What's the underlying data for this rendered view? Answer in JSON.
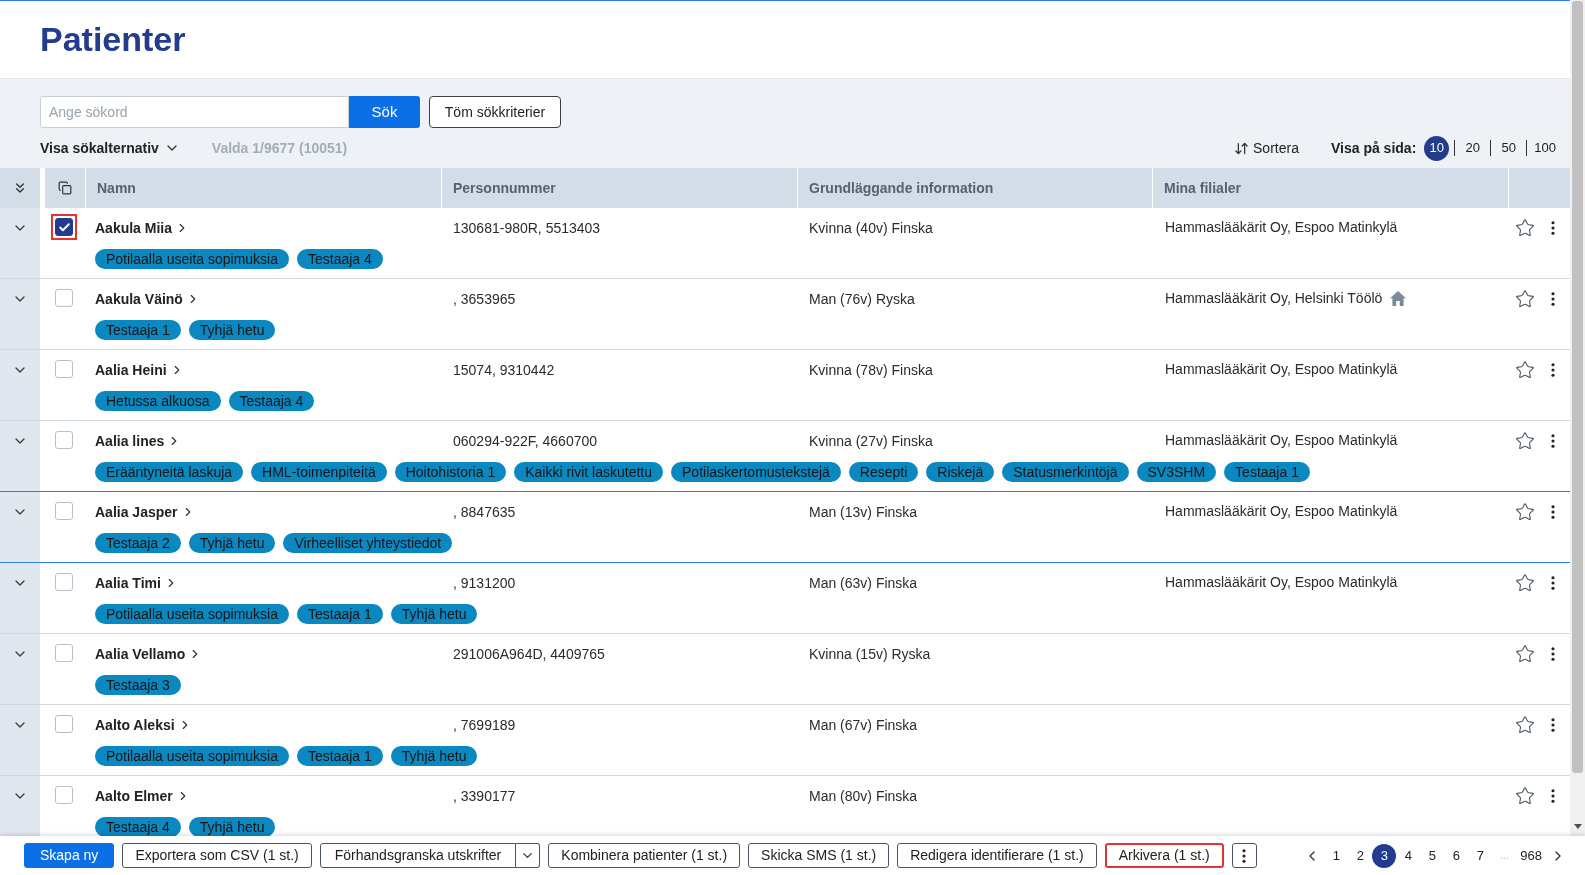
{
  "page": {
    "title": "Patienter"
  },
  "search": {
    "placeholder": "Ange sökord",
    "submit": "Sök",
    "clear": "Töm sökkriterier",
    "options_toggle": "Visa sökalternativ",
    "selection_info": "Valda 1/9677 (10051)"
  },
  "sort": {
    "label": "Sortera"
  },
  "page_size": {
    "label": "Visa på sida:",
    "options": [
      {
        "label": "10",
        "selected": true
      },
      {
        "label": "20",
        "selected": false
      },
      {
        "label": "50",
        "selected": false
      },
      {
        "label": "100",
        "selected": false
      }
    ]
  },
  "table": {
    "columns": [
      "Namn",
      "Personnummer",
      "Grundläggande information",
      "Mina filialer"
    ],
    "rows": [
      {
        "name": "Aakula Miia",
        "checked": true,
        "checkbox_highlighted": true,
        "focused": false,
        "personal_number": "130681-980R, 5513403",
        "info": "Kvinna (40v) Finska",
        "branch": "Hammaslääkärit Oy, Espoo Matinkylä",
        "home_branch": false,
        "favorite": false,
        "tags": [
          "Potilaalla useita sopimuksia",
          "Testaaja 4"
        ]
      },
      {
        "name": "Aakula Väinö",
        "checked": false,
        "checkbox_highlighted": false,
        "focused": false,
        "personal_number": ", 3653965",
        "info": "Man (76v) Ryska",
        "branch": "Hammaslääkärit Oy, Helsinki Töölö",
        "home_branch": true,
        "favorite": false,
        "tags": [
          "Testaaja 1",
          "Tyhjä hetu"
        ]
      },
      {
        "name": "Aalia Heini",
        "checked": false,
        "checkbox_highlighted": false,
        "focused": false,
        "personal_number": "15074, 9310442",
        "info": "Kvinna (78v) Finska",
        "branch": "Hammaslääkärit Oy, Espoo Matinkylä",
        "home_branch": false,
        "favorite": false,
        "tags": [
          "Hetussa alkuosa",
          "Testaaja 4"
        ]
      },
      {
        "name": "Aalia lines",
        "checked": false,
        "checkbox_highlighted": false,
        "focused": false,
        "personal_number": "060294-922F, 4660700",
        "info": "Kvinna (27v) Finska",
        "branch": "Hammaslääkärit Oy, Espoo Matinkylä",
        "home_branch": false,
        "favorite": false,
        "tags": [
          "Erääntyneitä laskuja",
          "HML-toimenpiteitä",
          "Hoitohistoria 1",
          "Kaikki rivit laskutettu",
          "Potilaskertomustekstejä",
          "Resepti",
          "Riskejä",
          "Statusmerkintöjä",
          "SV3SHM",
          "Testaaja 1"
        ]
      },
      {
        "name": "Aalia Jasper",
        "checked": false,
        "checkbox_highlighted": false,
        "focused": true,
        "personal_number": ", 8847635",
        "info": "Man (13v) Finska",
        "branch": "Hammaslääkärit Oy, Espoo Matinkylä",
        "home_branch": false,
        "favorite": false,
        "tags": [
          "Testaaja 2",
          "Tyhjä hetu",
          "Virheelliset yhteystiedot"
        ]
      },
      {
        "name": "Aalia Timi",
        "checked": false,
        "checkbox_highlighted": false,
        "focused": false,
        "personal_number": ", 9131200",
        "info": "Man (63v) Finska",
        "branch": "Hammaslääkärit Oy, Espoo Matinkylä",
        "home_branch": false,
        "favorite": false,
        "tags": [
          "Potilaalla useita sopimuksia",
          "Testaaja 1",
          "Tyhjä hetu"
        ]
      },
      {
        "name": "Aalia Vellamo",
        "checked": false,
        "checkbox_highlighted": false,
        "focused": false,
        "personal_number": "291006A964D, 4409765",
        "info": "Kvinna (15v) Ryska",
        "home_branch": false,
        "favorite": false,
        "tags": [
          "Testaaja 3"
        ]
      },
      {
        "name": "Aalto Aleksi",
        "checked": false,
        "checkbox_highlighted": false,
        "focused": false,
        "personal_number": ", 7699189",
        "info": "Man (67v) Finska",
        "home_branch": false,
        "favorite": false,
        "tags": [
          "Potilaalla useita sopimuksia",
          "Testaaja 1",
          "Tyhjä hetu"
        ]
      },
      {
        "name": "Aalto Elmer",
        "checked": false,
        "checkbox_highlighted": false,
        "focused": false,
        "personal_number": ", 3390177",
        "info": "Man (80v) Finska",
        "home_branch": false,
        "favorite": false,
        "tags": [
          "Testaaja 4",
          "Tyhjä hetu"
        ]
      }
    ]
  },
  "actions": [
    {
      "kind": "primary",
      "label": "Skapa ny",
      "highlighted": false
    },
    {
      "kind": "outline",
      "label": "Exportera som CSV (1 st.)",
      "highlighted": false
    },
    {
      "kind": "split",
      "label": "Förhandsgranska utskrifter",
      "highlighted": false
    },
    {
      "kind": "outline",
      "label": "Kombinera patienter (1 st.)",
      "highlighted": false
    },
    {
      "kind": "outline",
      "label": "Skicka SMS (1 st.)",
      "highlighted": false
    },
    {
      "kind": "outline",
      "label": "Redigera identifierare (1 st.)",
      "highlighted": false
    },
    {
      "kind": "outline",
      "label": "Arkivera (1 st.)",
      "highlighted": true
    },
    {
      "kind": "more",
      "highlighted": false
    }
  ],
  "pagination": {
    "pages": [
      {
        "label": "1",
        "selected": false
      },
      {
        "label": "2",
        "selected": false
      },
      {
        "label": "3",
        "selected": true
      },
      {
        "label": "4",
        "selected": false
      },
      {
        "label": "5",
        "selected": false
      },
      {
        "label": "6",
        "selected": false
      },
      {
        "label": "7",
        "selected": false
      }
    ],
    "ellipsis": "...",
    "last": {
      "label": "968",
      "selected": false
    }
  }
}
